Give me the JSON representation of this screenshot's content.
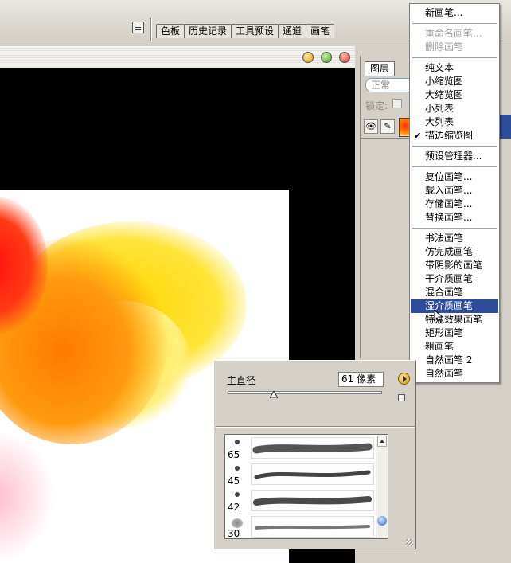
{
  "well_tabs": [
    "色板",
    "历史记录",
    "工具预设",
    "通道",
    "画笔"
  ],
  "layers": {
    "tab_label": "图层",
    "blend_mode": "正常",
    "lock_label": "锁定:"
  },
  "menu": {
    "items": [
      {
        "label": "新画笔...",
        "enabled": true
      },
      {
        "label": "重命名画笔...",
        "enabled": false
      },
      {
        "label": "删除画笔",
        "enabled": false
      },
      {
        "label": "纯文本",
        "enabled": true
      },
      {
        "label": "小缩览图",
        "enabled": true
      },
      {
        "label": "大缩览图",
        "enabled": true
      },
      {
        "label": "小列表",
        "enabled": true
      },
      {
        "label": "大列表",
        "enabled": true
      },
      {
        "label": "描边缩览图",
        "enabled": true,
        "checked": true
      },
      {
        "label": "预设管理器...",
        "enabled": true
      },
      {
        "label": "复位画笔...",
        "enabled": true
      },
      {
        "label": "载入画笔...",
        "enabled": true
      },
      {
        "label": "存储画笔...",
        "enabled": true
      },
      {
        "label": "替换画笔...",
        "enabled": true
      },
      {
        "label": "书法画笔",
        "enabled": true
      },
      {
        "label": "仿完成画笔",
        "enabled": true
      },
      {
        "label": "带阴影的画笔",
        "enabled": true
      },
      {
        "label": "干介质画笔",
        "enabled": true
      },
      {
        "label": "混合画笔",
        "enabled": true
      },
      {
        "label": "湿介质画笔",
        "enabled": true,
        "highlighted": true
      },
      {
        "label": "特殊效果画笔",
        "enabled": true
      },
      {
        "label": "矩形画笔",
        "enabled": true
      },
      {
        "label": "粗画笔",
        "enabled": true
      },
      {
        "label": "自然画笔 2",
        "enabled": true
      },
      {
        "label": "自然画笔",
        "enabled": true
      }
    ]
  },
  "brush_picker": {
    "diameter_label": "主直径",
    "diameter_value": "61 像素",
    "diameter_level": 0.3,
    "brushes": [
      {
        "size": "65"
      },
      {
        "size": "45"
      },
      {
        "size": "42"
      },
      {
        "size": "30"
      }
    ]
  },
  "colors": {
    "menu_highlight": "#2d4d9a",
    "paint_red": "#ff2a10",
    "paint_orange": "#ff8a00",
    "paint_yellow": "#ffe820"
  }
}
